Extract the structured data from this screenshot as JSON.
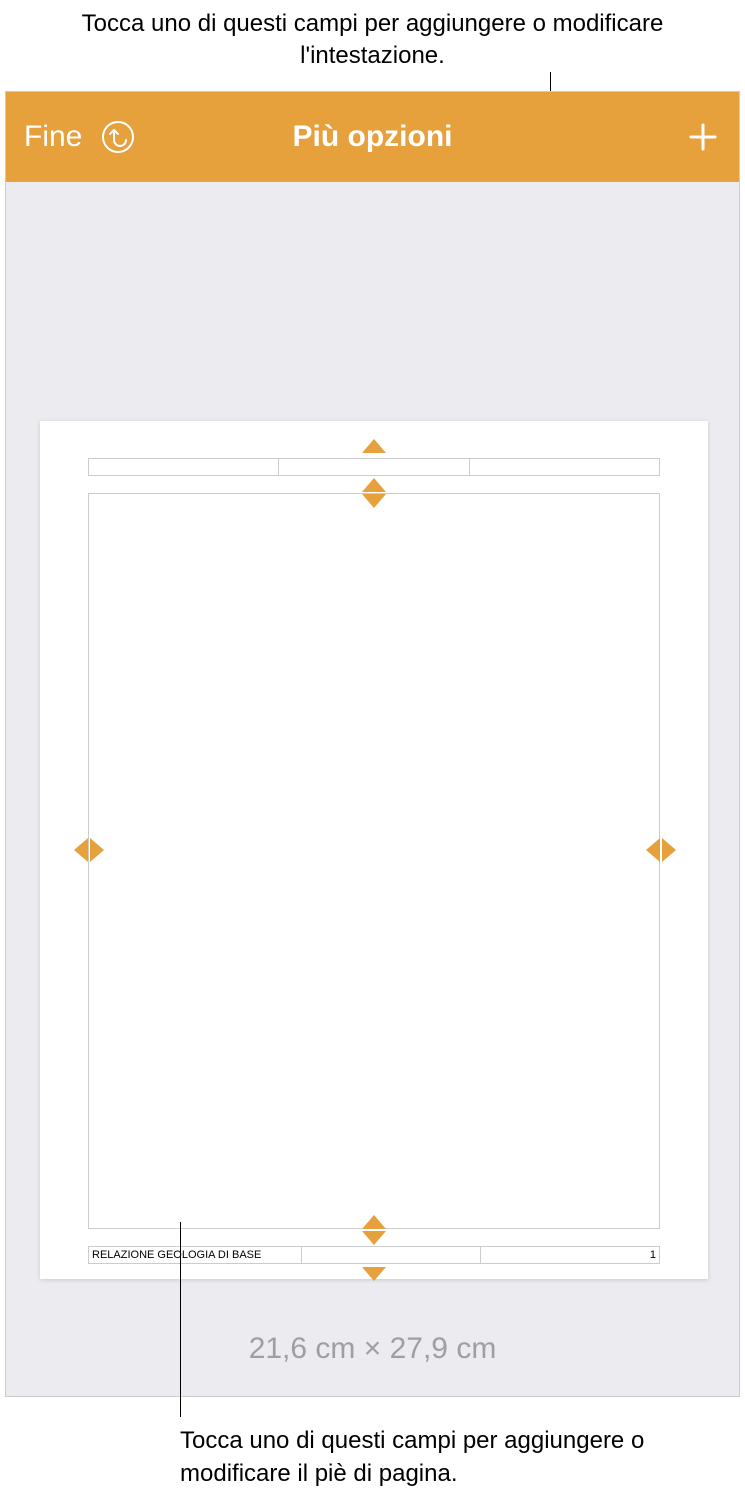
{
  "callouts": {
    "top": "Tocca uno di questi campi per aggiungere o modificare l'intestazione.",
    "bottom": "Tocca uno di questi campi per aggiungere o modificare il piè di pagina."
  },
  "toolbar": {
    "done_label": "Fine",
    "title": "Più opzioni"
  },
  "header": {
    "left": "",
    "center": "",
    "right": ""
  },
  "footer": {
    "left": "RELAZIONE GEOLOGIA DI BASE",
    "center": "",
    "right": "1"
  },
  "dimensions": "21,6 cm × 27,9 cm",
  "colors": {
    "accent": "#e6a03c"
  }
}
